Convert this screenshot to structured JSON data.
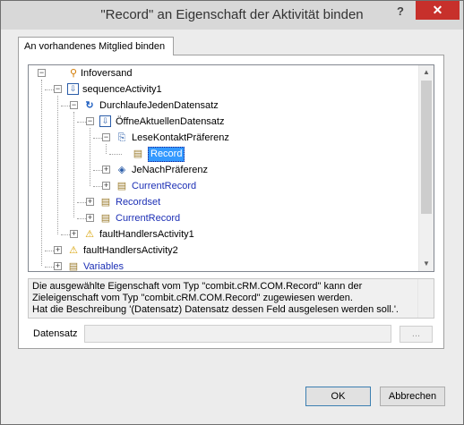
{
  "window": {
    "title": "\"Record\" an Eigenschaft der Aktivität binden",
    "help_glyph": "?",
    "close_glyph": "✕"
  },
  "tab": {
    "label": "An vorhandenes Mitglied binden"
  },
  "tree": {
    "nodes": [
      {
        "label": "Infoversand",
        "icon": "workflow-icon",
        "color": "#000000"
      },
      {
        "label": "sequenceActivity1",
        "icon": "sequence-icon",
        "color": "#000000"
      },
      {
        "label": "DurchlaufeJedenDatensatz",
        "icon": "loop-icon",
        "color": "#000000"
      },
      {
        "label": "ÖffneAktuellenDatensatz",
        "icon": "sequence-icon",
        "color": "#000000"
      },
      {
        "label": "LeseKontaktPräferenz",
        "icon": "activity-icon",
        "color": "#000000"
      },
      {
        "label": "Record",
        "icon": "property-icon",
        "color": "#ffffff",
        "selected": true
      },
      {
        "label": "JeNachPräferenz",
        "icon": "branch-icon",
        "color": "#000000"
      },
      {
        "label": "CurrentRecord",
        "icon": "property-icon",
        "color": "#1c2fb5"
      },
      {
        "label": "Recordset",
        "icon": "property-icon",
        "color": "#1c2fb5"
      },
      {
        "label": "CurrentRecord",
        "icon": "property-icon",
        "color": "#1c2fb5"
      },
      {
        "label": "faultHandlersActivity1",
        "icon": "fault-handler-icon",
        "color": "#000000"
      },
      {
        "label": "faultHandlersActivity2",
        "icon": "fault-handler-icon",
        "color": "#000000"
      },
      {
        "label": "Variables",
        "icon": "property-icon",
        "color": "#1c2fb5"
      }
    ]
  },
  "description": {
    "line1": "Die ausgewählte Eigenschaft vom Typ \"combit.cRM.COM.Record\" kann der",
    "line2": "Zieleigenschaft vom Typ \"combit.cRM.COM.Record\" zugewiesen werden.",
    "line3": "Hat die Beschreibung '(Datensatz) Datensatz dessen Feld ausgelesen werden soll.'."
  },
  "field": {
    "label": "Datensatz",
    "value": "",
    "browse_label": "..."
  },
  "buttons": {
    "ok": "OK",
    "cancel": "Abbrechen"
  },
  "colors": {
    "selection": "#3399ff",
    "member_link": "#1c2fb5",
    "close_button": "#c7302b"
  }
}
